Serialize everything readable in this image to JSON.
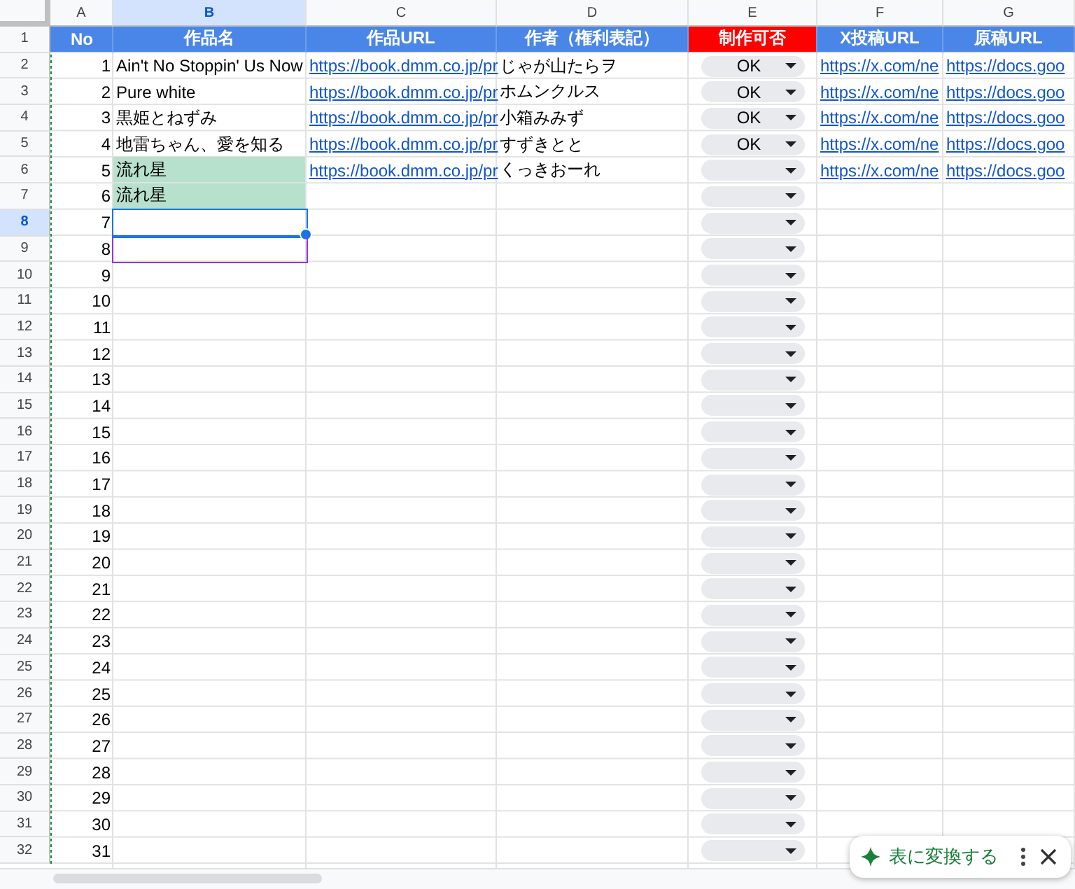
{
  "columns": [
    {
      "letter": "A",
      "selected": false
    },
    {
      "letter": "B",
      "selected": true
    },
    {
      "letter": "C",
      "selected": false
    },
    {
      "letter": "D",
      "selected": false
    },
    {
      "letter": "E",
      "selected": false
    },
    {
      "letter": "F",
      "selected": false
    },
    {
      "letter": "G",
      "selected": false
    }
  ],
  "header_row": {
    "row": "1",
    "selected": false,
    "cells": [
      {
        "text": "No",
        "color": "#4a86e8"
      },
      {
        "text": "作品名",
        "color": "#4a86e8"
      },
      {
        "text": "作品URL",
        "color": "#4a86e8"
      },
      {
        "text": "作者（権利表記）",
        "color": "#4a86e8"
      },
      {
        "text": "制作可否",
        "color": "#ff0000"
      },
      {
        "text": "X投稿URL",
        "color": "#4a86e8"
      },
      {
        "text": "原稿URL",
        "color": "#4a86e8"
      }
    ]
  },
  "rows": [
    {
      "row": "2",
      "selected": false,
      "no": "1",
      "title": "Ain't No Stoppin' Us Now",
      "url": "https://book.dmm.co.jp/pr",
      "author": "じゃが山たらヲ",
      "dropdown": true,
      "status": "OK",
      "x_url": "https://x.com/ne",
      "draft_url": "https://docs.goo"
    },
    {
      "row": "3",
      "selected": false,
      "no": "2",
      "title": "Pure white",
      "url": "https://book.dmm.co.jp/pr",
      "author": "ホムンクルス",
      "dropdown": true,
      "status": "OK",
      "x_url": "https://x.com/ne",
      "draft_url": "https://docs.goo"
    },
    {
      "row": "4",
      "selected": false,
      "no": "3",
      "title": "黒姫とねずみ",
      "url": "https://book.dmm.co.jp/pr",
      "author": "小箱みみず",
      "dropdown": true,
      "status": "OK",
      "x_url": "https://x.com/ne",
      "draft_url": "https://docs.goo"
    },
    {
      "row": "5",
      "selected": false,
      "no": "4",
      "title": "地雷ちゃん、愛を知る",
      "url": "https://book.dmm.co.jp/pr",
      "author": "すずきとと",
      "dropdown": true,
      "status": "OK",
      "x_url": "https://x.com/ne",
      "draft_url": "https://docs.goo"
    },
    {
      "row": "6",
      "selected": false,
      "no": "5",
      "title": "流れ星",
      "highlighted": true,
      "url": "https://book.dmm.co.jp/pr",
      "author": "くっきおーれ",
      "dropdown": true,
      "x_url": "https://x.com/ne",
      "draft_url": "https://docs.goo"
    },
    {
      "row": "7",
      "selected": false,
      "no": "6",
      "title": "流れ星",
      "highlighted": true,
      "dropdown": true
    },
    {
      "row": "8",
      "selected": true,
      "no": "7",
      "dropdown": true
    },
    {
      "row": "9",
      "selected": false,
      "no": "8",
      "other_cursor": true,
      "dropdown": true
    },
    {
      "row": "10",
      "selected": false,
      "no": "9",
      "dropdown": true
    },
    {
      "row": "11",
      "selected": false,
      "no": "10",
      "dropdown": true
    },
    {
      "row": "12",
      "selected": false,
      "no": "11",
      "dropdown": true
    },
    {
      "row": "13",
      "selected": false,
      "no": "12",
      "dropdown": true
    },
    {
      "row": "14",
      "selected": false,
      "no": "13",
      "dropdown": true
    },
    {
      "row": "15",
      "selected": false,
      "no": "14",
      "dropdown": true
    },
    {
      "row": "16",
      "selected": false,
      "no": "15",
      "dropdown": true
    },
    {
      "row": "17",
      "selected": false,
      "no": "16",
      "dropdown": true
    },
    {
      "row": "18",
      "selected": false,
      "no": "17",
      "dropdown": true
    },
    {
      "row": "19",
      "selected": false,
      "no": "18",
      "dropdown": true
    },
    {
      "row": "20",
      "selected": false,
      "no": "19",
      "dropdown": true
    },
    {
      "row": "21",
      "selected": false,
      "no": "20",
      "dropdown": true
    },
    {
      "row": "22",
      "selected": false,
      "no": "21",
      "dropdown": true
    },
    {
      "row": "23",
      "selected": false,
      "no": "22",
      "dropdown": true
    },
    {
      "row": "24",
      "selected": false,
      "no": "23",
      "dropdown": true
    },
    {
      "row": "25",
      "selected": false,
      "no": "24",
      "dropdown": true
    },
    {
      "row": "26",
      "selected": false,
      "no": "25",
      "dropdown": true
    },
    {
      "row": "27",
      "selected": false,
      "no": "26",
      "dropdown": true
    },
    {
      "row": "28",
      "selected": false,
      "no": "27",
      "dropdown": true
    },
    {
      "row": "29",
      "selected": false,
      "no": "28",
      "dropdown": true
    },
    {
      "row": "30",
      "selected": false,
      "no": "29",
      "dropdown": true
    },
    {
      "row": "31",
      "selected": false,
      "no": "30",
      "dropdown": true
    },
    {
      "row": "32",
      "selected": false,
      "no": "31",
      "dropdown": true
    }
  ],
  "toast": {
    "label": "表に変換する"
  }
}
